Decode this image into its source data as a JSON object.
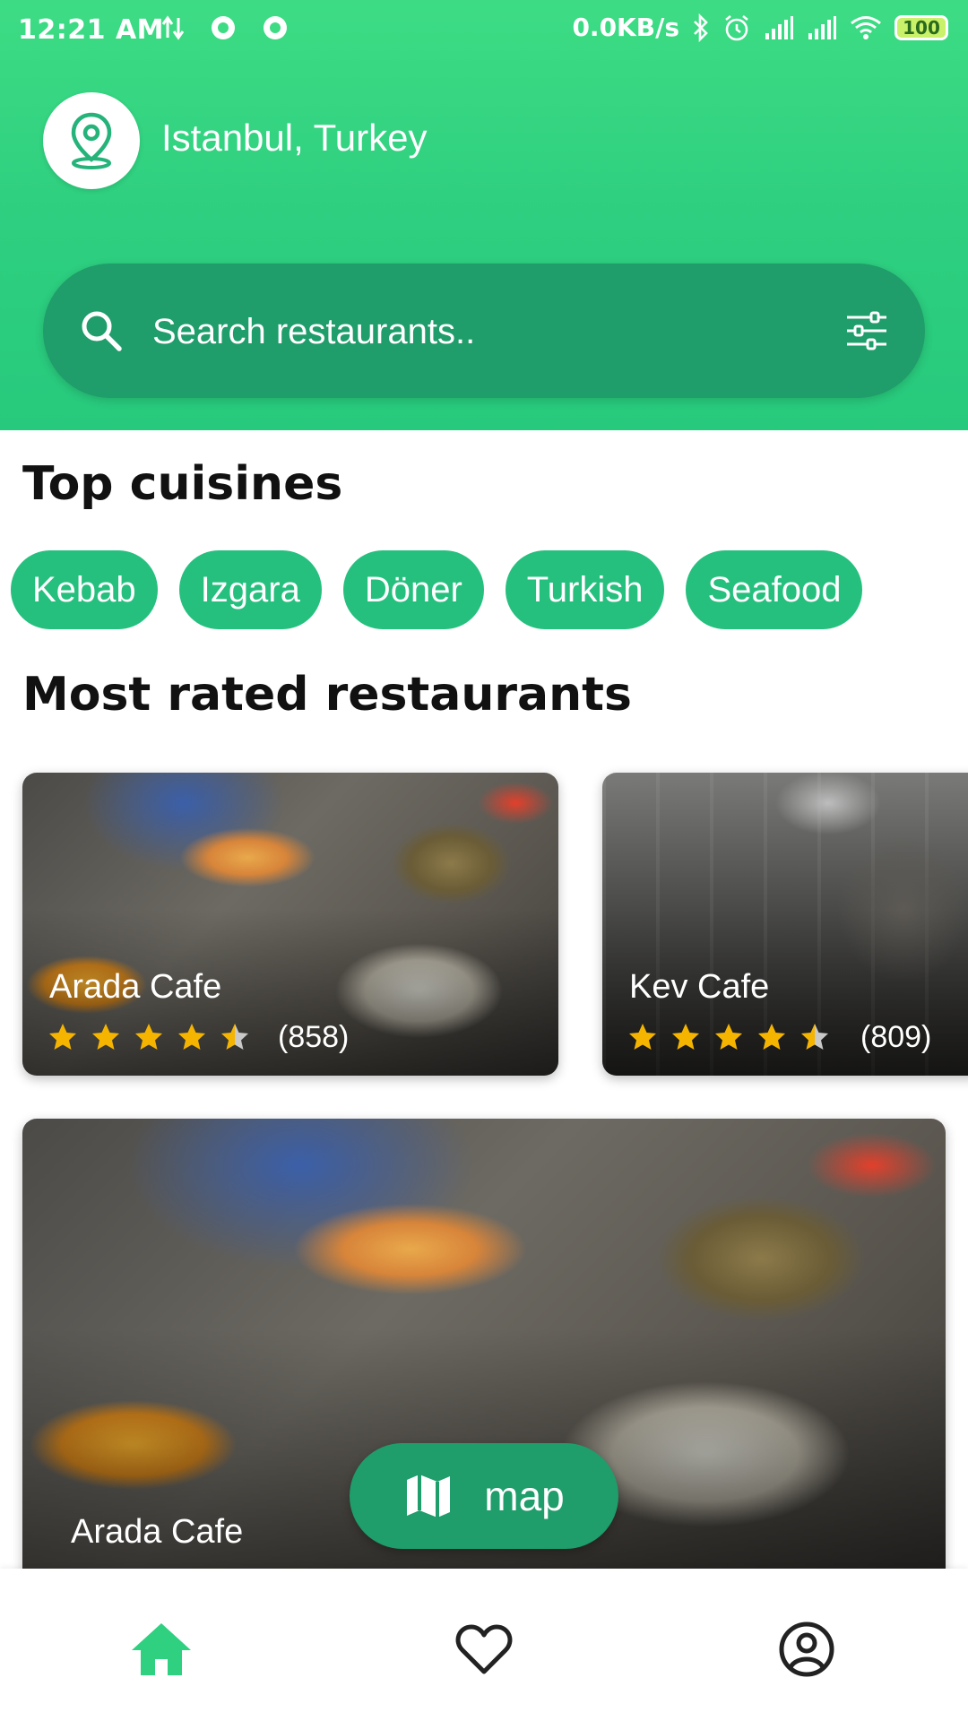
{
  "status_bar": {
    "time": "12:21 AM",
    "speed": "0.0KB/s",
    "battery": "100",
    "icons": [
      "data-transfer-icon",
      "circle-notification-icon",
      "circle-notification-icon",
      "bluetooth-icon",
      "alarm-icon",
      "signal-icon",
      "signal-icon",
      "wifi-icon",
      "battery-icon"
    ]
  },
  "header": {
    "location": "Istanbul, Turkey",
    "location_icon": "location-pin-icon",
    "search_placeholder": "Search restaurants..",
    "filter_icon": "sliders-icon",
    "accent": "#2fd080",
    "search_bg": "#1f9d6a"
  },
  "cuisines": {
    "title": "Top cuisines",
    "items": [
      "Kebab",
      "Izgara",
      "Döner",
      "Turkish",
      "Seafood"
    ],
    "chip_color": "#25c07e"
  },
  "restaurants": {
    "title": "Most rated restaurants",
    "items": [
      {
        "name": "Arada Cafe",
        "rating": 4.5,
        "count": "(858)"
      },
      {
        "name": "Kev Cafe",
        "rating": 4.5,
        "count": "(809)"
      }
    ],
    "featured": {
      "name": "Arada Cafe"
    },
    "star_color": "#f5b400"
  },
  "map_button": {
    "label": "map",
    "icon": "map-icon"
  },
  "bottom_nav": {
    "items": [
      {
        "icon": "home-icon",
        "active": true
      },
      {
        "icon": "heart-icon",
        "active": false
      },
      {
        "icon": "account-circle-icon",
        "active": false
      }
    ],
    "active_color": "#2fd080"
  }
}
